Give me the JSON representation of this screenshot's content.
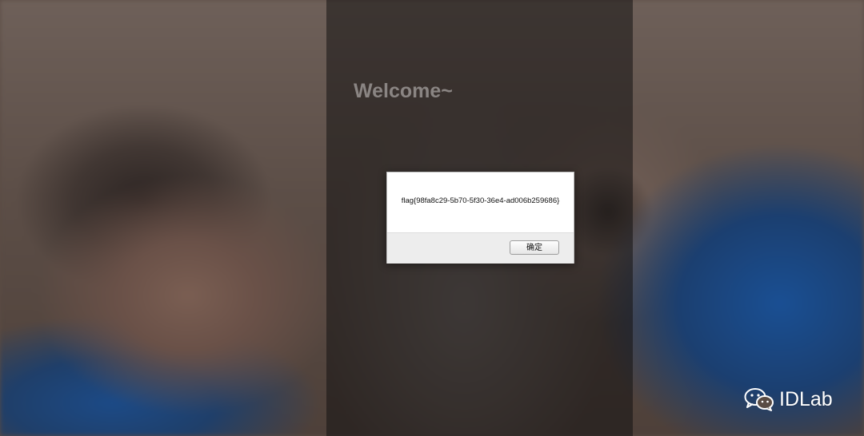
{
  "page": {
    "welcome_text": "Welcome~"
  },
  "alert_dialog": {
    "message": "flag{98fa8c29-5b70-5f30-36e4-ad006b259686}",
    "ok_label": "确定"
  },
  "watermark": {
    "icon": "wechat-icon",
    "text": "IDLab"
  },
  "colors": {
    "overlay_panel": "#141212",
    "welcome_text": "#8a8583",
    "dialog_body": "#ffffff",
    "dialog_footer": "#ededed",
    "watermark_text": "#ffffff"
  }
}
